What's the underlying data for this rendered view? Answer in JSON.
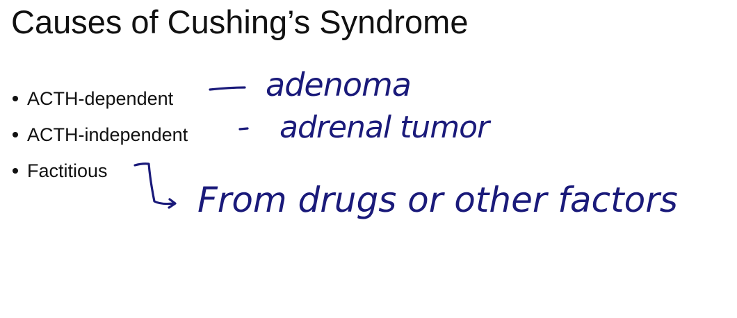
{
  "slide": {
    "title": "Causes of Cushing’s Syndrome",
    "bullets": [
      {
        "label": "ACTH-dependent"
      },
      {
        "label": "ACTH-independent"
      },
      {
        "label": "Factitious"
      }
    ]
  },
  "annotations": {
    "ink_color": "#1a1a7a",
    "notes": [
      {
        "text": "adenoma"
      },
      {
        "text": "adrenal tumor"
      },
      {
        "text": "From drugs or other factors"
      }
    ]
  }
}
